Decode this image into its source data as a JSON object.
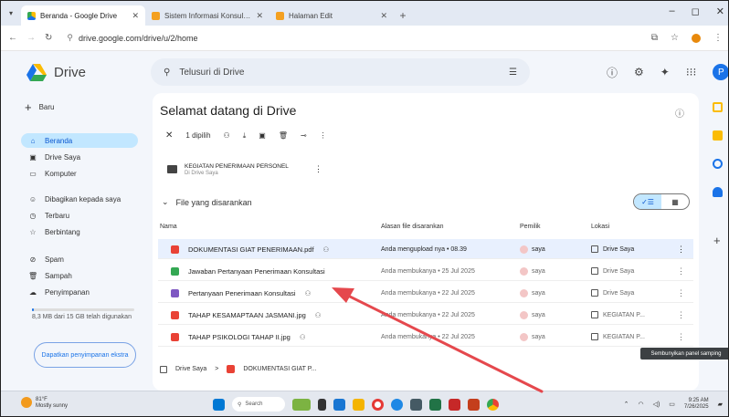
{
  "browser": {
    "tabs": [
      {
        "title": "Beranda - Google Drive",
        "active": true,
        "color": "#1a73e8"
      },
      {
        "title": "Sistem Informasi Konsultasi Pr",
        "active": false,
        "color": "#f4a020"
      },
      {
        "title": "Halaman Edit",
        "active": false,
        "color": "#f4a020"
      }
    ],
    "url": "drive.google.com/drive/u/2/home"
  },
  "drive": {
    "app_name": "Drive",
    "search_placeholder": "Telusuri di Drive",
    "avatar_letter": "P"
  },
  "sidebar": {
    "new_label": "Baru",
    "items": [
      {
        "label": "Beranda",
        "icon": "home-icon",
        "active": true
      },
      {
        "label": "Drive Saya",
        "icon": "drive-icon",
        "active": false
      },
      {
        "label": "Komputer",
        "icon": "computer-icon",
        "active": false
      },
      {
        "label": "Dibagikan kepada saya",
        "icon": "people-icon",
        "active": false
      },
      {
        "label": "Terbaru",
        "icon": "clock-icon",
        "active": false
      },
      {
        "label": "Berbintang",
        "icon": "star-icon",
        "active": false
      },
      {
        "label": "Spam",
        "icon": "spam-icon",
        "active": false
      },
      {
        "label": "Sampah",
        "icon": "trash-icon",
        "active": false
      },
      {
        "label": "Penyimpanan",
        "icon": "cloud-icon",
        "active": false
      }
    ],
    "storage_text": "8,3 MB dari 15 GB telah digunakan",
    "storage_fraction": 0.02,
    "get_storage": "Dapatkan penyimpanan ekstra"
  },
  "main": {
    "welcome": "Selamat datang di Drive",
    "selected_count": "1 dipilih",
    "suggested_folder": {
      "name": "KEGIATAN PENERIMAAN PERSONEL",
      "sub": "Di Drive Saya"
    },
    "file_section": "File yang disarankan",
    "columns": {
      "name": "Nama",
      "reason": "Alasan file disarankan",
      "owner": "Pemilik",
      "location": "Lokasi"
    },
    "files": [
      {
        "name": "DOKUMENTASI GIAT PENERIMAAN.pdf",
        "shared": true,
        "reason": "Anda mengupload nya • 08.39",
        "owner": "saya",
        "location": "Drive Saya",
        "icon_color": "#e94235",
        "selected": true
      },
      {
        "name": "Jawaban Pertanyaan Penerimaan Konsultasi",
        "shared": false,
        "reason": "Anda membukanya • 25 Jul 2025",
        "owner": "saya",
        "location": "Drive Saya",
        "icon_color": "#34a853",
        "selected": false
      },
      {
        "name": "Pertanyaan Penerimaan Konsultasi",
        "shared": true,
        "reason": "Anda membukanya • 22 Jul 2025",
        "owner": "saya",
        "location": "Drive Saya",
        "icon_color": "#7e57c2",
        "selected": false
      },
      {
        "name": "TAHAP KESAMAPTAAN JASMANI.jpg",
        "shared": true,
        "reason": "Anda membukanya • 22 Jul 2025",
        "owner": "saya",
        "location": "KEGIATAN P...",
        "icon_color": "#e94235",
        "selected": false
      },
      {
        "name": "TAHAP PSIKOLOGI TAHAP II.jpg",
        "shared": true,
        "reason": "Anda membukanya • 22 Jul 2025",
        "owner": "saya",
        "location": "KEGIATAN P...",
        "icon_color": "#e94235",
        "selected": false
      }
    ],
    "breadcrumb": {
      "root": "Drive Saya",
      "sep": ">",
      "current": "DOKUMENTASI GIAT P..."
    }
  },
  "tooltip": "Sembunyikan panel samping",
  "taskbar": {
    "temp": "81°F",
    "weather": "Mostly sunny",
    "search": "Search",
    "time": "9:25 AM",
    "date": "7/26/2025"
  },
  "colors": {
    "accent": "#1a73e8",
    "selected_row": "#e8f0fe",
    "nav_active": "#c2e7ff",
    "annotation_arrow": "#e5484d"
  }
}
